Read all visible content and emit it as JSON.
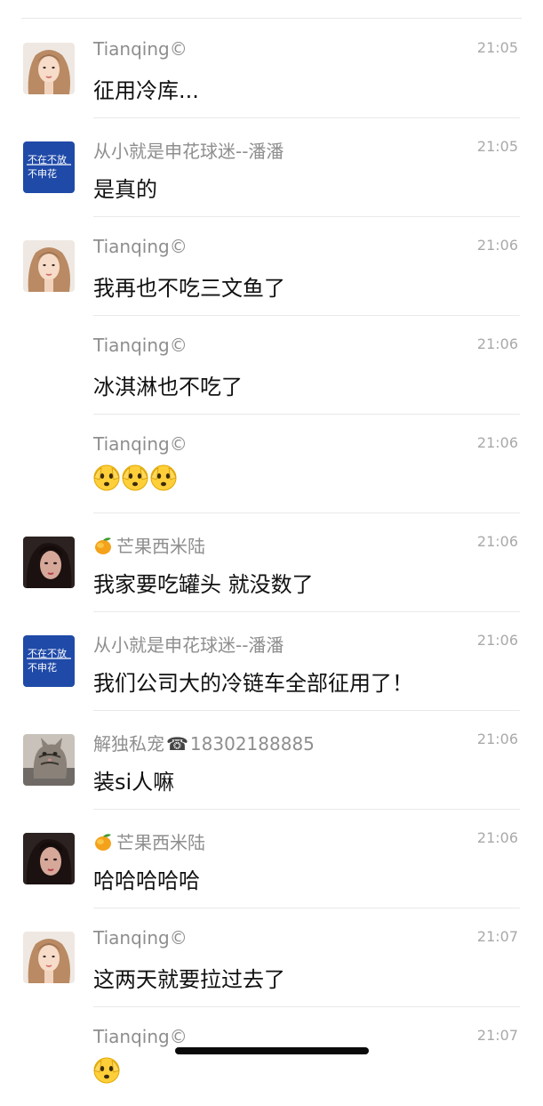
{
  "messages": [
    {
      "sender": "Tianqing©",
      "time": "21:05",
      "text": "征用冷库...",
      "avatar": "girl"
    },
    {
      "sender": "从小就是申花球迷--潘潘",
      "time": "21:05",
      "text": "是真的",
      "avatar": "shenhua"
    },
    {
      "sender": "Tianqing©",
      "time": "21:06",
      "text": "我再也不吃三文鱼了",
      "avatar": "girl"
    },
    {
      "sender": "Tianqing©",
      "time": "21:06",
      "text": "冰淇淋也不吃了",
      "avatar": ""
    },
    {
      "sender": "Tianqing©",
      "time": "21:06",
      "text": "",
      "avatar": ""
    },
    {
      "sender": "芒果西米陆",
      "time": "21:06",
      "text": "我家要吃罐头 就没数了",
      "avatar": "woman"
    },
    {
      "sender": "从小就是申花球迷--潘潘",
      "time": "21:06",
      "text": "我们公司大的冷链车全部征用了！",
      "avatar": "shenhua"
    },
    {
      "sender": "解独私宠",
      "sender_phone": "18302188885",
      "time": "21:06",
      "text": "装si人嘛",
      "avatar": "cat"
    },
    {
      "sender": "芒果西米陆",
      "time": "21:06",
      "text": "哈哈哈哈哈",
      "avatar": "woman"
    },
    {
      "sender": "Tianqing©",
      "time": "21:07",
      "text": "这两天就要拉过去了",
      "avatar": "girl"
    },
    {
      "sender": "Tianqing©",
      "time": "21:07",
      "text": "",
      "avatar": ""
    }
  ],
  "badge": {
    "logo_top": "不在不放",
    "logo_bottom": "不申花"
  },
  "icons": {
    "mango": "mango-emoji-icon",
    "phone": "phone-emoji-icon",
    "face": "blushing-face-emoji-icon"
  }
}
